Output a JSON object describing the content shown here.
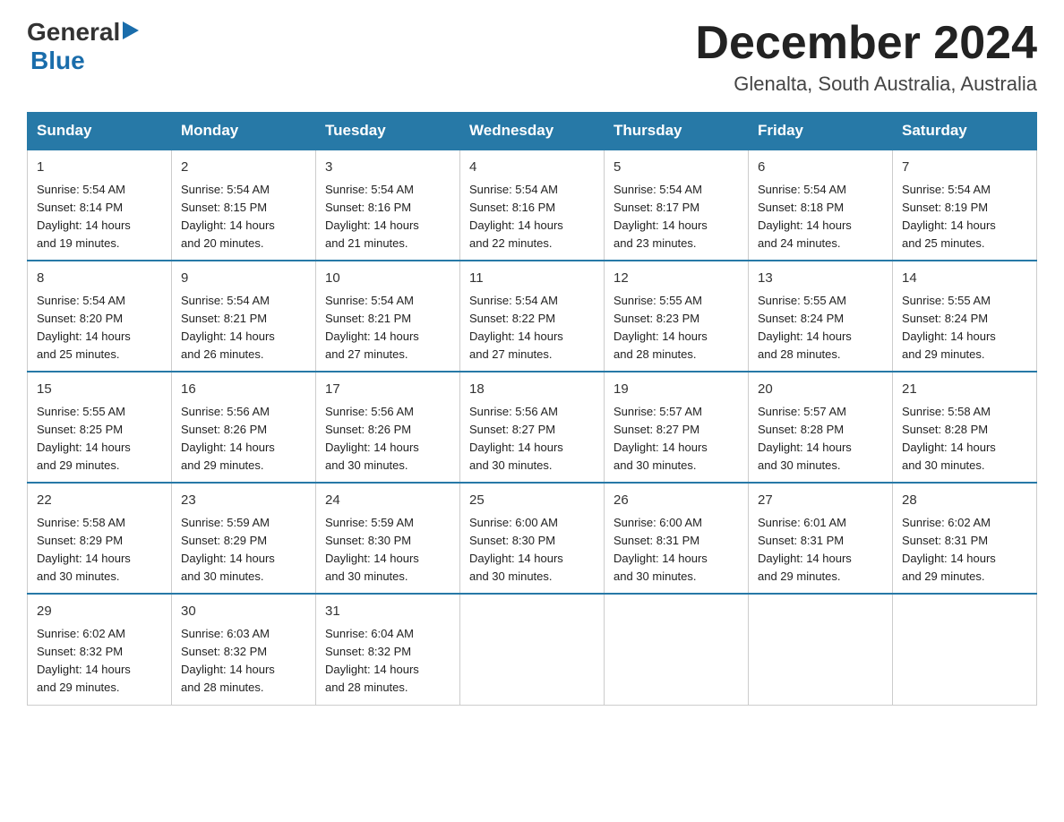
{
  "header": {
    "logo_general": "General",
    "logo_blue": "Blue",
    "title": "December 2024",
    "subtitle": "Glenalta, South Australia, Australia"
  },
  "days_of_week": [
    "Sunday",
    "Monday",
    "Tuesday",
    "Wednesday",
    "Thursday",
    "Friday",
    "Saturday"
  ],
  "weeks": [
    [
      {
        "day": "1",
        "info": "Sunrise: 5:54 AM\nSunset: 8:14 PM\nDaylight: 14 hours\nand 19 minutes."
      },
      {
        "day": "2",
        "info": "Sunrise: 5:54 AM\nSunset: 8:15 PM\nDaylight: 14 hours\nand 20 minutes."
      },
      {
        "day": "3",
        "info": "Sunrise: 5:54 AM\nSunset: 8:16 PM\nDaylight: 14 hours\nand 21 minutes."
      },
      {
        "day": "4",
        "info": "Sunrise: 5:54 AM\nSunset: 8:16 PM\nDaylight: 14 hours\nand 22 minutes."
      },
      {
        "day": "5",
        "info": "Sunrise: 5:54 AM\nSunset: 8:17 PM\nDaylight: 14 hours\nand 23 minutes."
      },
      {
        "day": "6",
        "info": "Sunrise: 5:54 AM\nSunset: 8:18 PM\nDaylight: 14 hours\nand 24 minutes."
      },
      {
        "day": "7",
        "info": "Sunrise: 5:54 AM\nSunset: 8:19 PM\nDaylight: 14 hours\nand 25 minutes."
      }
    ],
    [
      {
        "day": "8",
        "info": "Sunrise: 5:54 AM\nSunset: 8:20 PM\nDaylight: 14 hours\nand 25 minutes."
      },
      {
        "day": "9",
        "info": "Sunrise: 5:54 AM\nSunset: 8:21 PM\nDaylight: 14 hours\nand 26 minutes."
      },
      {
        "day": "10",
        "info": "Sunrise: 5:54 AM\nSunset: 8:21 PM\nDaylight: 14 hours\nand 27 minutes."
      },
      {
        "day": "11",
        "info": "Sunrise: 5:54 AM\nSunset: 8:22 PM\nDaylight: 14 hours\nand 27 minutes."
      },
      {
        "day": "12",
        "info": "Sunrise: 5:55 AM\nSunset: 8:23 PM\nDaylight: 14 hours\nand 28 minutes."
      },
      {
        "day": "13",
        "info": "Sunrise: 5:55 AM\nSunset: 8:24 PM\nDaylight: 14 hours\nand 28 minutes."
      },
      {
        "day": "14",
        "info": "Sunrise: 5:55 AM\nSunset: 8:24 PM\nDaylight: 14 hours\nand 29 minutes."
      }
    ],
    [
      {
        "day": "15",
        "info": "Sunrise: 5:55 AM\nSunset: 8:25 PM\nDaylight: 14 hours\nand 29 minutes."
      },
      {
        "day": "16",
        "info": "Sunrise: 5:56 AM\nSunset: 8:26 PM\nDaylight: 14 hours\nand 29 minutes."
      },
      {
        "day": "17",
        "info": "Sunrise: 5:56 AM\nSunset: 8:26 PM\nDaylight: 14 hours\nand 30 minutes."
      },
      {
        "day": "18",
        "info": "Sunrise: 5:56 AM\nSunset: 8:27 PM\nDaylight: 14 hours\nand 30 minutes."
      },
      {
        "day": "19",
        "info": "Sunrise: 5:57 AM\nSunset: 8:27 PM\nDaylight: 14 hours\nand 30 minutes."
      },
      {
        "day": "20",
        "info": "Sunrise: 5:57 AM\nSunset: 8:28 PM\nDaylight: 14 hours\nand 30 minutes."
      },
      {
        "day": "21",
        "info": "Sunrise: 5:58 AM\nSunset: 8:28 PM\nDaylight: 14 hours\nand 30 minutes."
      }
    ],
    [
      {
        "day": "22",
        "info": "Sunrise: 5:58 AM\nSunset: 8:29 PM\nDaylight: 14 hours\nand 30 minutes."
      },
      {
        "day": "23",
        "info": "Sunrise: 5:59 AM\nSunset: 8:29 PM\nDaylight: 14 hours\nand 30 minutes."
      },
      {
        "day": "24",
        "info": "Sunrise: 5:59 AM\nSunset: 8:30 PM\nDaylight: 14 hours\nand 30 minutes."
      },
      {
        "day": "25",
        "info": "Sunrise: 6:00 AM\nSunset: 8:30 PM\nDaylight: 14 hours\nand 30 minutes."
      },
      {
        "day": "26",
        "info": "Sunrise: 6:00 AM\nSunset: 8:31 PM\nDaylight: 14 hours\nand 30 minutes."
      },
      {
        "day": "27",
        "info": "Sunrise: 6:01 AM\nSunset: 8:31 PM\nDaylight: 14 hours\nand 29 minutes."
      },
      {
        "day": "28",
        "info": "Sunrise: 6:02 AM\nSunset: 8:31 PM\nDaylight: 14 hours\nand 29 minutes."
      }
    ],
    [
      {
        "day": "29",
        "info": "Sunrise: 6:02 AM\nSunset: 8:32 PM\nDaylight: 14 hours\nand 29 minutes."
      },
      {
        "day": "30",
        "info": "Sunrise: 6:03 AM\nSunset: 8:32 PM\nDaylight: 14 hours\nand 28 minutes."
      },
      {
        "day": "31",
        "info": "Sunrise: 6:04 AM\nSunset: 8:32 PM\nDaylight: 14 hours\nand 28 minutes."
      },
      {
        "day": "",
        "info": ""
      },
      {
        "day": "",
        "info": ""
      },
      {
        "day": "",
        "info": ""
      },
      {
        "day": "",
        "info": ""
      }
    ]
  ]
}
